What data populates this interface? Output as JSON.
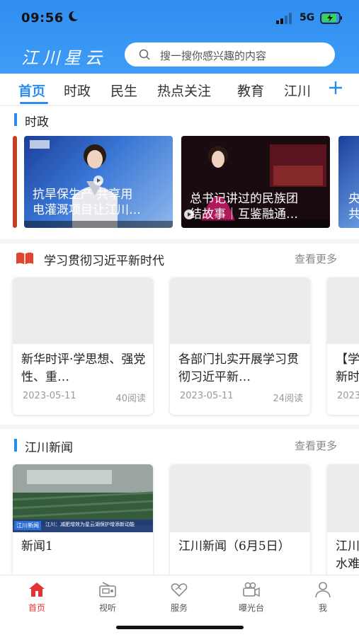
{
  "status_bar": {
    "time": "09:56",
    "network": "5G"
  },
  "header": {
    "brand": "江川星云",
    "search_placeholder": "搜一搜你感兴趣的内容"
  },
  "tabs": [
    {
      "label": "首页",
      "active": true
    },
    {
      "label": "时政"
    },
    {
      "label": "民生"
    },
    {
      "label": "热点关注"
    },
    {
      "label": "教育"
    },
    {
      "label": "江川"
    }
  ],
  "sections": {
    "politics": {
      "title": "时政",
      "videos": [
        {
          "caption_line1": "抗旱保生产  共享用",
          "caption_line2": "电灌溉项目让江川…"
        },
        {
          "caption_line1": "总书记讲过的民族团",
          "caption_line2": "结故事｜互鉴融通…"
        },
        {
          "caption_line1": "央",
          "caption_line2": "共"
        }
      ]
    },
    "study": {
      "title": "学习贯彻习近平新时代",
      "more": "查看更多",
      "cards": [
        {
          "title": "新华时评·学思想、强党性、重…",
          "date": "2023-05-11",
          "reads": "40阅读"
        },
        {
          "title": "各部门扎实开展学习贯彻习近平新…",
          "date": "2023-05-11",
          "reads": "24阅读"
        },
        {
          "title": "【学新时",
          "date": "2023",
          "reads": ""
        }
      ]
    },
    "news": {
      "title": "江川新闻",
      "more": "查看更多",
      "cards": [
        {
          "title": "新闻1",
          "thumb_label": "江川新闻",
          "thumb_subtitle": "江川：减肥增效为星云湖保护增添新动能"
        },
        {
          "title": "江川新闻（6月5日）"
        },
        {
          "title": "江川水难"
        }
      ]
    }
  },
  "bottom_nav": [
    {
      "label": "首页",
      "icon": "home-icon",
      "active": true
    },
    {
      "label": "视听",
      "icon": "radio-icon"
    },
    {
      "label": "服务",
      "icon": "service-icon"
    },
    {
      "label": "曝光台",
      "icon": "camera-icon"
    },
    {
      "label": "我",
      "icon": "user-icon"
    }
  ],
  "colors": {
    "accent": "#2a8cf0",
    "header": "#3e9cf6",
    "nav_active": "#e33333"
  }
}
